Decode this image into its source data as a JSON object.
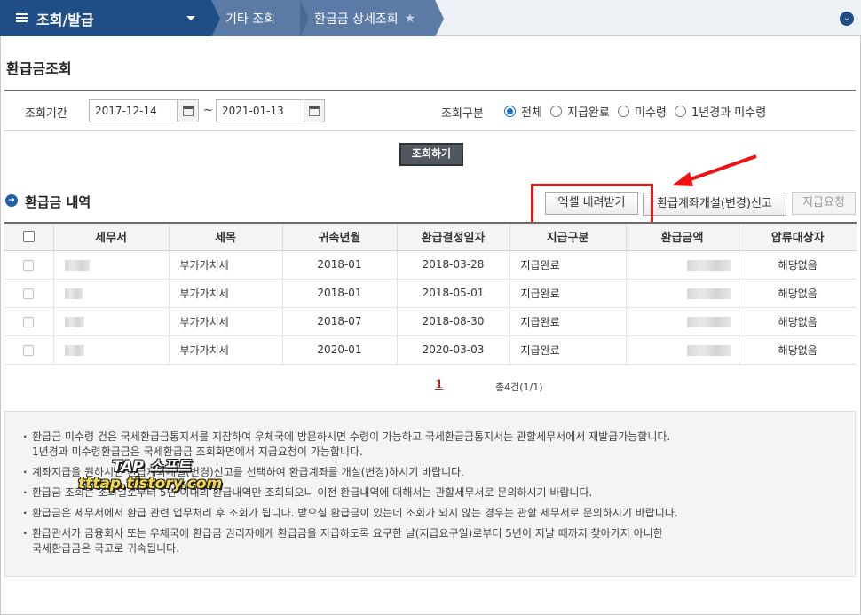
{
  "topbar": {
    "menu_title": "조회/발급",
    "breadcrumb": [
      "기타 조회",
      "환급금 상세조회"
    ]
  },
  "page_title": "환급금조회",
  "search": {
    "period_label": "조회기간",
    "date_from": "2017-12-14",
    "date_sep": "~",
    "date_to": "2021-01-13",
    "type_label": "조회구분",
    "options": [
      "전체",
      "지급완료",
      "미수령",
      "1년경과 미수령"
    ],
    "selected_option": "전체",
    "search_button": "조회하기"
  },
  "section": {
    "title": "환급금 내역",
    "buttons": {
      "excel": "엑셀 내려받기",
      "account": "환급계좌개설(변경)신고",
      "request": "지급요청"
    }
  },
  "table": {
    "columns": [
      "세무서",
      "세목",
      "귀속년월",
      "환급결정일자",
      "지급구분",
      "환급금액",
      "압류대상자"
    ],
    "rows": [
      {
        "tax_type": "부가가치세",
        "period": "2018-01",
        "decision_date": "2018-03-28",
        "status": "지급완료",
        "seizure": "해당없음"
      },
      {
        "tax_type": "부가가치세",
        "period": "2018-01",
        "decision_date": "2018-05-01",
        "status": "지급완료",
        "seizure": "해당없음"
      },
      {
        "tax_type": "부가가치세",
        "period": "2018-07",
        "decision_date": "2018-08-30",
        "status": "지급완료",
        "seizure": "해당없음"
      },
      {
        "tax_type": "부가가치세",
        "period": "2020-01",
        "decision_date": "2020-03-03",
        "status": "지급완료",
        "seizure": "해당없음"
      }
    ]
  },
  "pagination": {
    "current_page": "1",
    "total_text": "총4건(1/1)"
  },
  "notes": [
    {
      "line1": "환급금 미수령 건은 국세환급금통지서를 지참하여 우체국에 방문하시면 수령이 가능하고 국세환급금통지서는 관할세무서에서 재발급가능합니다.",
      "line2": "1년경과 미수령환급금은 국세환급금 조회화면에서 지급요청이 가능합니다."
    },
    {
      "line1": "계좌지급을 원하시면 환급계좌개설(변경)신고를 선택하여 환급계좌를 개설(변경)하시기 바랍니다.",
      "line2": ""
    },
    {
      "line1": "환급금 조회는 조회일로부터 5년 이내의 환급내역만 조회되오니 이전 환급내역에 대해서는 관할세무서로 문의하시기 바랍니다.",
      "line2": ""
    },
    {
      "line1": "환급금은 세무서에서 환급 관련 업무처리 후 조회가 됩니다. 받으실 환급금이 있는데 조회가 되지 않는 경우는 관할 세무서로 문의하시기 바랍니다.",
      "line2": ""
    },
    {
      "line1": "환급관서가 금융회사 또는 우체국에 환급금 권리자에게 환급금을 지급하도록 요구한 날(지급요구일)로부터 5년이 지날 때까지 찾아가지 아니한",
      "line2": "국세환급금은 국고로 귀속됩니다."
    }
  ],
  "watermark": {
    "line1": "TAP 소프트",
    "line2": "tttap.tistory.com"
  },
  "colors": {
    "nav_dark": "#1f4d86",
    "nav_light": "#5b7aa5",
    "highlight_red": "#ee1111",
    "radio_blue": "#1a6fd1"
  }
}
